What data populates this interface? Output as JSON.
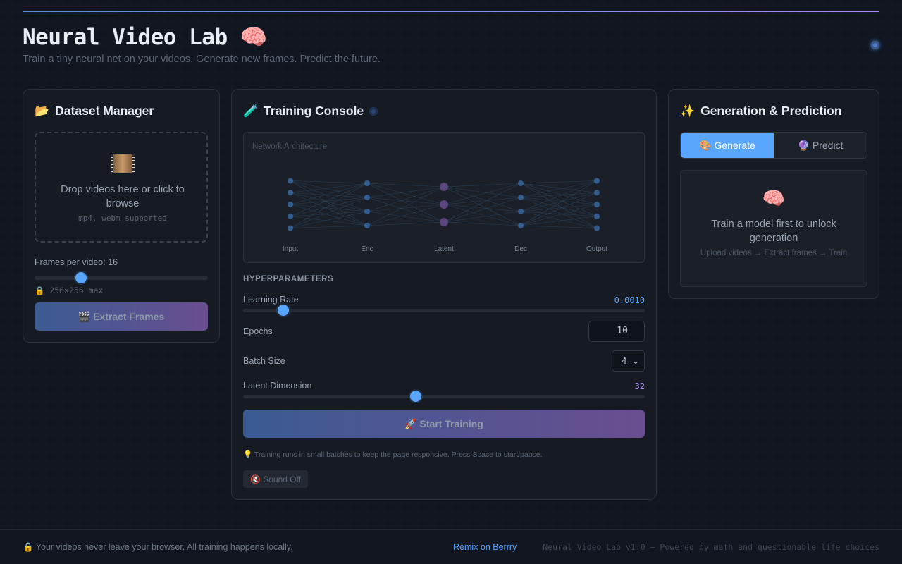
{
  "header": {
    "title": "Neural Video Lab 🧠",
    "subtitle": "Train a tiny neural net on your videos. Generate new frames. Predict the future."
  },
  "dataset": {
    "title_emoji": "📂",
    "title": "Dataset Manager",
    "drop_text": "Drop videos here or click to browse",
    "drop_hint": "mp4, webm supported",
    "frames_label": "Frames per video: 16",
    "frames_value": 16,
    "frames_slider_fraction": 0.27,
    "size_note": "🔒 256×256 max",
    "extract_label": "🎬 Extract Frames"
  },
  "training": {
    "title_emoji": "🧪",
    "title": "Training Console",
    "arch_label": "Network Architecture",
    "layers": [
      {
        "name": "Input",
        "nodes": 5
      },
      {
        "name": "Enc",
        "nodes": 4
      },
      {
        "name": "Latent",
        "nodes": 3
      },
      {
        "name": "Dec",
        "nodes": 4
      },
      {
        "name": "Output",
        "nodes": 5
      }
    ],
    "hp_heading": "HYPERPARAMETERS",
    "learning_rate_label": "Learning Rate",
    "learning_rate_value": "0.0010",
    "learning_rate_fraction": 0.1,
    "epochs_label": "Epochs",
    "epochs_value": "10",
    "batch_label": "Batch Size",
    "batch_value": "4",
    "latent_label": "Latent Dimension",
    "latent_value": "32",
    "latent_fraction": 0.43,
    "start_label": "🚀 Start Training",
    "tip": "💡 Training runs in small batches to keep the page responsive. Press Space to start/pause.",
    "sound_label": "🔇 Sound Off"
  },
  "generation": {
    "title_emoji": "✨",
    "title": "Generation & Prediction",
    "tabs": [
      "🎨 Generate",
      "🔮 Predict"
    ],
    "active_tab": "🎨 Generate",
    "empty_emoji": "🧠",
    "empty_text": "Train a model first to unlock generation",
    "empty_hint": "Upload videos → Extract frames → Train"
  },
  "footer": {
    "privacy": "🔒  Your videos never leave your browser. All training happens locally.",
    "remix_link": "Remix on Berrry",
    "credit": "Neural Video Lab v1.0 — Powered by math and questionable life choices"
  },
  "colors": {
    "accent": "#58a6ff",
    "latent_node": "#6a4e90",
    "node": "#3b6fb0"
  }
}
